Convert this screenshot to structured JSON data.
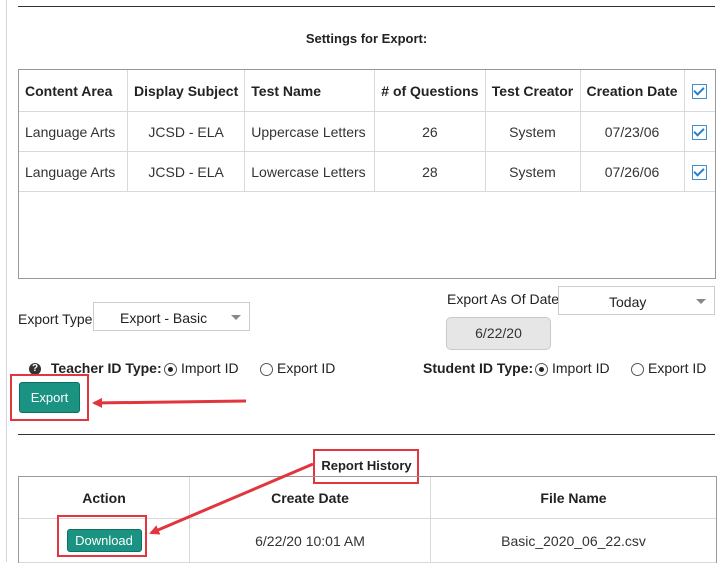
{
  "settings_title": "Settings for Export:",
  "grid": {
    "columns": [
      "Content Area",
      "Display Subject",
      "Test Name",
      "# of Questions",
      "Test Creator",
      "Creation Date"
    ],
    "rows": [
      [
        "Language Arts",
        "JCSD - ELA",
        "Uppercase Letters",
        "26",
        "System",
        "07/23/06"
      ],
      [
        "Language Arts",
        "JCSD - ELA",
        "Lowercase Letters",
        "28",
        "System",
        "07/26/06"
      ]
    ]
  },
  "export_type": {
    "label": "Export Type:",
    "value": "Export - Basic"
  },
  "export_as_of": {
    "label": "Export As Of Date:",
    "value": "Today",
    "date": "6/22/20"
  },
  "teacher_id": {
    "label": "Teacher ID Type:",
    "opt1": "Import ID",
    "opt2": "Export ID",
    "selected": "Import ID"
  },
  "student_id": {
    "label": "Student ID Type:",
    "opt1": "Import ID",
    "opt2": "Export ID",
    "selected": "Import ID"
  },
  "export_button": "Export",
  "report_history": {
    "title": "Report History",
    "columns": [
      "Action",
      "Create Date",
      "File Name"
    ],
    "rows": [
      {
        "action": "Download",
        "create_date": "6/22/20 10:01 AM",
        "file_name": "Basic_2020_06_22.csv"
      }
    ]
  },
  "colors": {
    "button": "#1a9383",
    "highlight": "#e2363e",
    "checkbox": "#2a7fc9"
  }
}
